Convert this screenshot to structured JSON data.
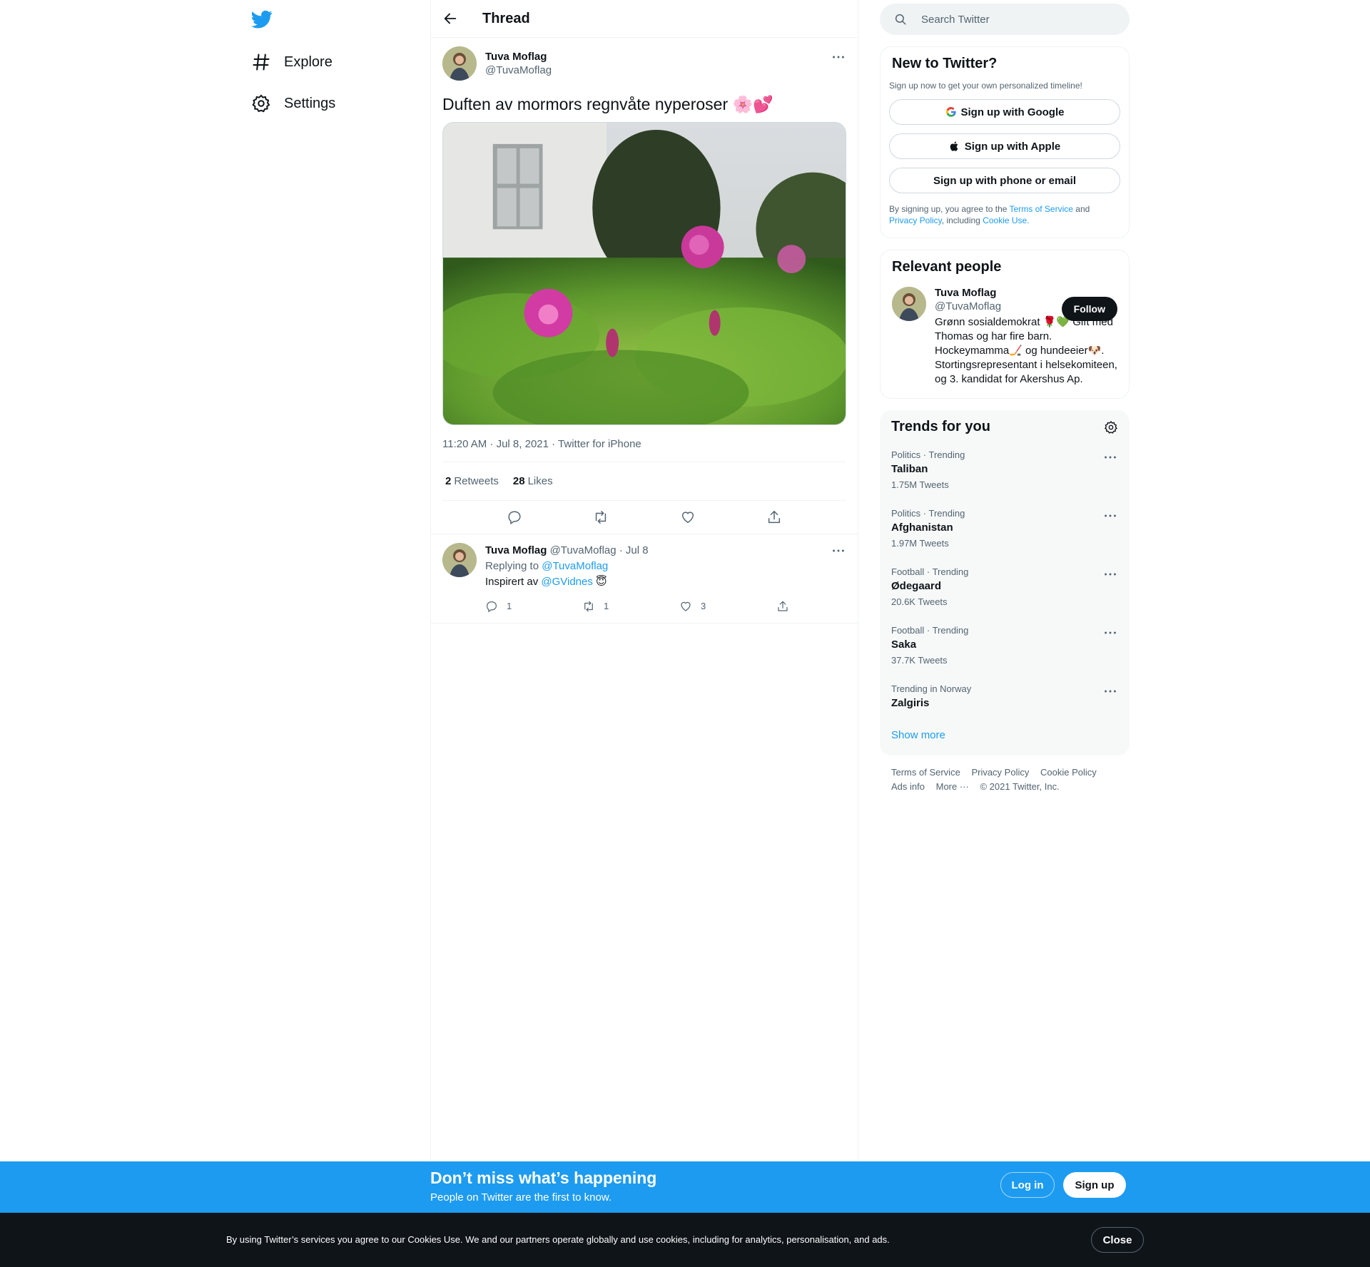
{
  "nav": {
    "logo": "twitter-bird-icon",
    "items": [
      {
        "label": "Explore",
        "icon": "hashtag-icon"
      },
      {
        "label": "Settings",
        "icon": "gear-icon"
      }
    ]
  },
  "header": {
    "title": "Thread"
  },
  "tweet": {
    "name": "Tuva Moflag",
    "handle": "@TuvaMoflag",
    "text": "Duften av mormors regnvåte nyperoser 🌸💕",
    "meta": "11:20 AM · Jul 8, 2021 · Twitter for iPhone",
    "retweets": "2",
    "retweets_label": "Retweets",
    "likes": "28",
    "likes_label": "Likes"
  },
  "reply": {
    "name": "Tuva Moflag",
    "handle_date": "@TuvaMoflag · Jul 8",
    "replying_to_label": "Replying to",
    "replying_to": "@TuvaMoflag",
    "text_prefix": "Inspirert av",
    "mention": "@GVidnes",
    "emoji": "😇",
    "replies": "1",
    "retweets": "1",
    "likes": "3"
  },
  "search": {
    "placeholder": "Search Twitter"
  },
  "signup_card": {
    "title": "New to Twitter?",
    "subtitle": "Sign up now to get your own personalized timeline!",
    "google": "Sign up with Google",
    "apple": "Sign up with Apple",
    "phone": "Sign up with phone or email",
    "legal_1": "By signing up, you agree to the",
    "terms": "Terms of Service",
    "legal_2": "and",
    "privacy": "Privacy Policy",
    "legal_3": ", including",
    "cookie": "Cookie Use."
  },
  "relevant": {
    "title": "Relevant people",
    "name": "Tuva Moflag",
    "handle": "@TuvaMoflag",
    "follow": "Follow",
    "bio": "Grønn sosialdemokrat 🌹💚 Gift med Thomas og har fire barn. Hockeymamma🏒 og hundeeier🐶. Stortingsrepresentant i helsekomiteen, og 3. kandidat for Akershus Ap."
  },
  "trends": {
    "title": "Trends for you",
    "items": [
      {
        "category": "Politics · Trending",
        "name": "Taliban",
        "count": "1.75M Tweets"
      },
      {
        "category": "Politics · Trending",
        "name": "Afghanistan",
        "count": "1.97M Tweets"
      },
      {
        "category": "Football · Trending",
        "name": "Ødegaard",
        "count": "20.6K Tweets"
      },
      {
        "category": "Football · Trending",
        "name": "Saka",
        "count": "37.7K Tweets"
      },
      {
        "category": "Trending in Norway",
        "name": "Zalgiris",
        "count": ""
      }
    ],
    "show_more": "Show more"
  },
  "footer": {
    "terms": "Terms of Service",
    "privacy": "Privacy Policy",
    "cookie": "Cookie Policy",
    "ads": "Ads info",
    "more": "More ···",
    "copyright": "© 2021 Twitter, Inc."
  },
  "banner": {
    "title": "Don’t miss what’s happening",
    "subtitle": "People on Twitter are the first to know.",
    "login": "Log in",
    "signup": "Sign up"
  },
  "cookie_bar": {
    "text": "By using Twitter’s services you agree to our Cookies Use. We and our partners operate globally and use cookies, including for analytics, personalisation, and ads.",
    "close": "Close"
  },
  "colors": {
    "accent": "#1d9bf0",
    "text": "#0f1419",
    "muted": "#536471",
    "border": "#eff3f4"
  }
}
